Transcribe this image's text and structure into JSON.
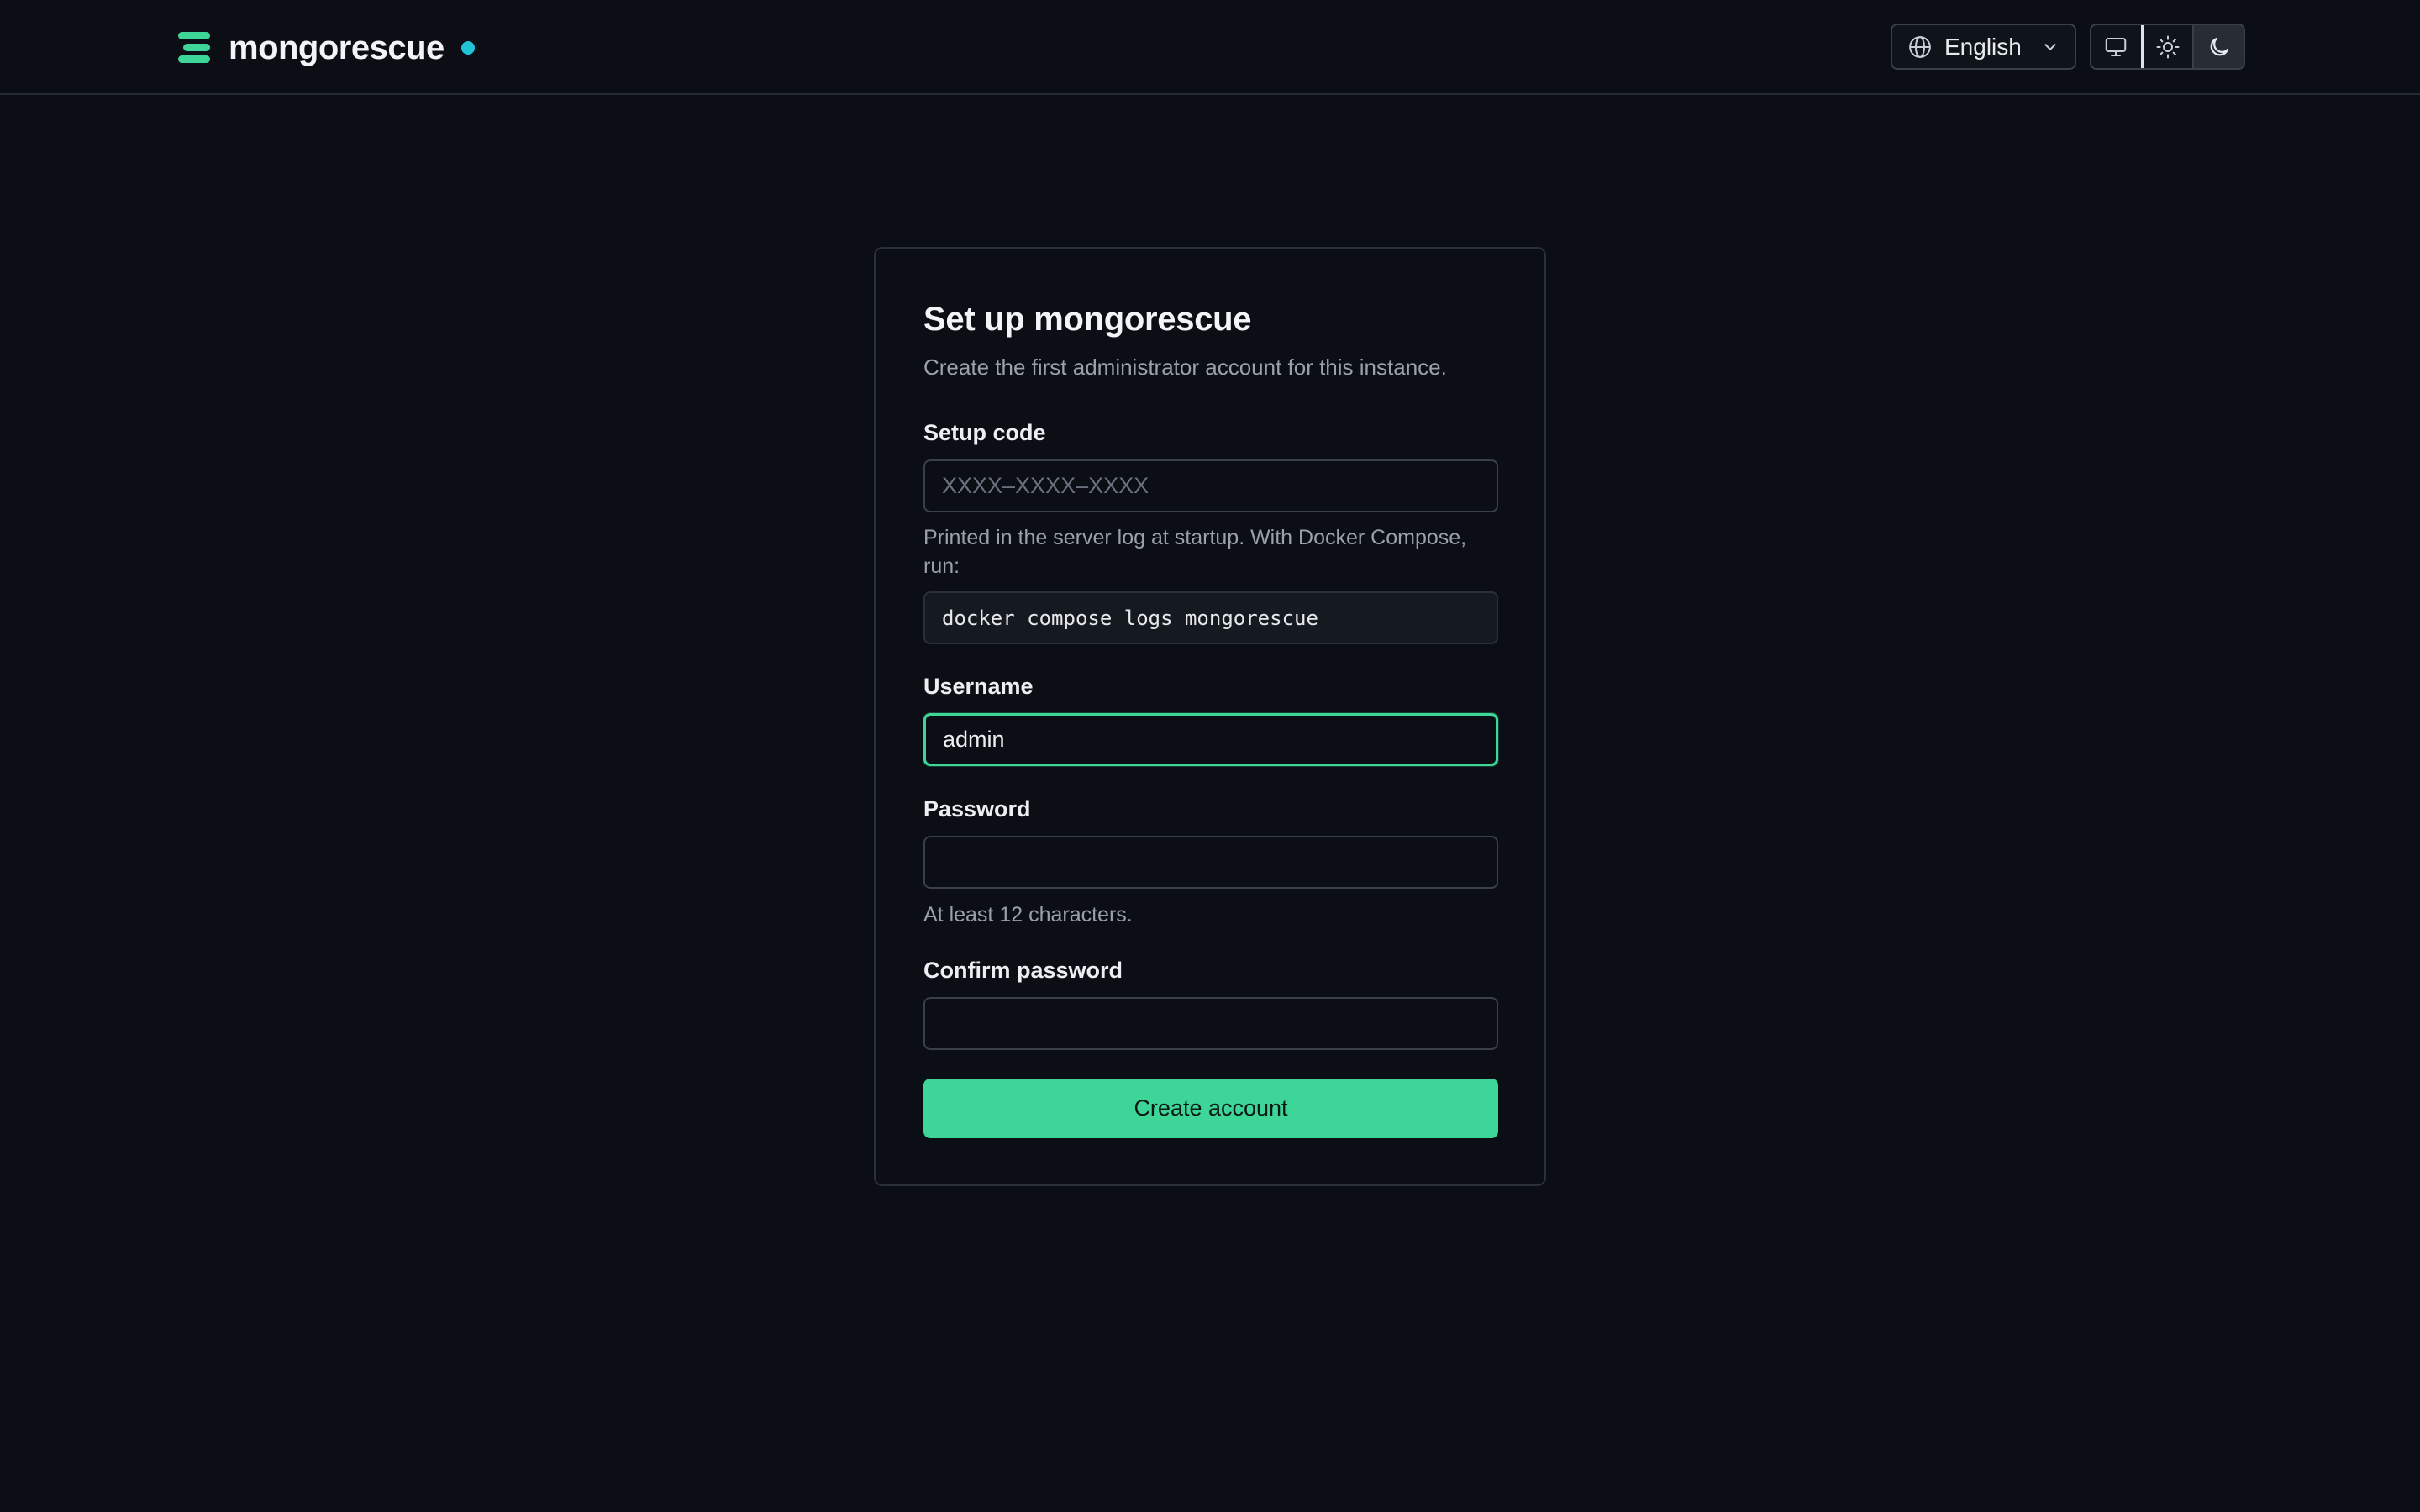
{
  "header": {
    "brand_name": "mongorescue",
    "brand_logo_icon": "database-stack-icon",
    "status_dot_color": "#22c3d8",
    "language": {
      "icon": "globe-icon",
      "selected": "English"
    },
    "theme_options": [
      {
        "name": "system",
        "icon": "monitor-icon",
        "active": false
      },
      {
        "name": "light",
        "icon": "sun-icon",
        "active": false
      },
      {
        "name": "dark",
        "icon": "moon-icon",
        "active": true
      }
    ]
  },
  "card": {
    "title": "Set up mongorescue",
    "subtitle": "Create the first administrator account for this instance.",
    "setup_code": {
      "label": "Setup code",
      "placeholder": "XXXX–XXXX–XXXX",
      "value": "",
      "hint": "Printed in the server log at startup. With Docker Compose, run:",
      "command": "docker compose logs mongorescue"
    },
    "username": {
      "label": "Username",
      "value": "admin"
    },
    "password": {
      "label": "Password",
      "value": "",
      "hint": "At least 12 characters."
    },
    "confirm_password": {
      "label": "Confirm password",
      "value": ""
    },
    "submit_label": "Create account"
  },
  "colors": {
    "background": "#0b0f15",
    "accent": "#3dd598",
    "status_dot": "#22c3d8"
  }
}
